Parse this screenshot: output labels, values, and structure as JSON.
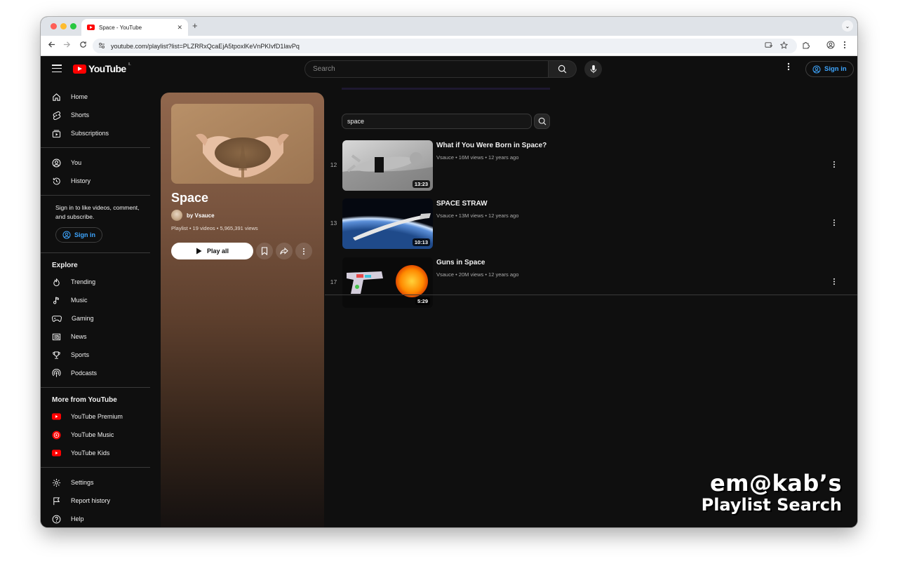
{
  "browser": {
    "tab_title": "Space - YouTube",
    "tab_close": "✕",
    "new_tab": "+",
    "tab_menu": "⌄",
    "url": "youtube.com/playlist?list=PLZRRxQcaEjA5tpoxlKeVnPKIvfD1lavPq",
    "nav_icons": [
      "back-arrow-icon",
      "forward-arrow-icon",
      "reload-icon"
    ]
  },
  "masthead": {
    "logo_text": "YouTube",
    "logo_country": "IL",
    "search_placeholder": "Search",
    "sign_in": "Sign in"
  },
  "sidebar": {
    "main": [
      {
        "label": "Home",
        "icon": "home-icon"
      },
      {
        "label": "Shorts",
        "icon": "shorts-icon"
      },
      {
        "label": "Subscriptions",
        "icon": "subscriptions-icon"
      }
    ],
    "you": [
      {
        "label": "You",
        "icon": "user-circle-icon"
      },
      {
        "label": "History",
        "icon": "history-icon"
      }
    ],
    "signin_prompt": "Sign in to like videos, comment, and subscribe.",
    "signin_button": "Sign in",
    "explore_heading": "Explore",
    "explore": [
      {
        "label": "Trending",
        "icon": "trending-icon"
      },
      {
        "label": "Music",
        "icon": "music-note-icon"
      },
      {
        "label": "Gaming",
        "icon": "gamepad-icon"
      },
      {
        "label": "News",
        "icon": "news-icon"
      },
      {
        "label": "Sports",
        "icon": "trophy-icon"
      },
      {
        "label": "Podcasts",
        "icon": "podcast-icon"
      }
    ],
    "more_heading": "More from YouTube",
    "more": [
      {
        "label": "YouTube Premium",
        "icon": "youtube-premium-icon"
      },
      {
        "label": "YouTube Music",
        "icon": "youtube-music-icon"
      },
      {
        "label": "YouTube Kids",
        "icon": "youtube-kids-icon"
      }
    ],
    "footer": [
      {
        "label": "Settings",
        "icon": "gear-icon"
      },
      {
        "label": "Report history",
        "icon": "flag-icon"
      },
      {
        "label": "Help",
        "icon": "help-icon"
      }
    ]
  },
  "playlist": {
    "title": "Space",
    "owner": "by Vsauce",
    "meta": "Playlist • 19 videos • 5,965,391 views",
    "play_all": "Play all"
  },
  "playlist_search": {
    "value": "space"
  },
  "videos": [
    {
      "index": "12",
      "title": "What if You Were Born in Space?",
      "meta": "Vsauce • 16M views • 12 years ago",
      "duration": "13:23"
    },
    {
      "index": "13",
      "title": "SPACE STRAW",
      "meta": "Vsauce • 13M views • 12 years ago",
      "duration": "10:13"
    },
    {
      "index": "17",
      "title": "Guns in Space",
      "meta": "Vsauce • 20M views • 12 years ago",
      "duration": "5:29"
    }
  ],
  "watermark": {
    "line1": "em@kab’s",
    "line2": "Playlist Search"
  },
  "colors": {
    "background": "#0f0f0f",
    "accent_blue": "#3ea6ff",
    "youtube_red": "#ff0000"
  }
}
